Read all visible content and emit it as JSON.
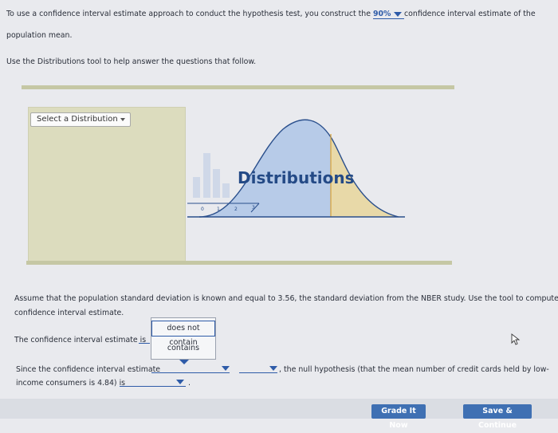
{
  "intro": {
    "line1_before": "To use a confidence interval estimate approach to conduct the hypothesis test, you construct the",
    "level_value": "90%",
    "line1_after": "confidence interval estimate of the",
    "line2": "population mean."
  },
  "instruction": "Use the Distributions tool to help answer the questions that follow.",
  "tool": {
    "select_label": "Select a Distribution",
    "logo_text": "Distributions",
    "ticks": [
      "0",
      "1",
      "2",
      "3"
    ]
  },
  "assume": {
    "line1": "Assume that the population standard deviation is known and equal to 3.56, the standard deviation from the NBER study. Use the tool to compute the",
    "line2": "confidence interval estimate."
  },
  "ci": {
    "label": "The confidence interval estimate is",
    "options": [
      "does not contain",
      "contains"
    ]
  },
  "since": {
    "line1_before": "Since the confidence interval estimate",
    "line1_after": ", the null hypothesis (that the mean number of credit cards held by low-",
    "line2": "income consumers is 4.84) is",
    "line2_end": "."
  },
  "buttons": {
    "grade": "Grade It Now",
    "save": "Save & Continue"
  },
  "colors": {
    "accent": "#2e5ba8",
    "button": "#3f70b3",
    "tool_panel": "#dcdcbe"
  }
}
